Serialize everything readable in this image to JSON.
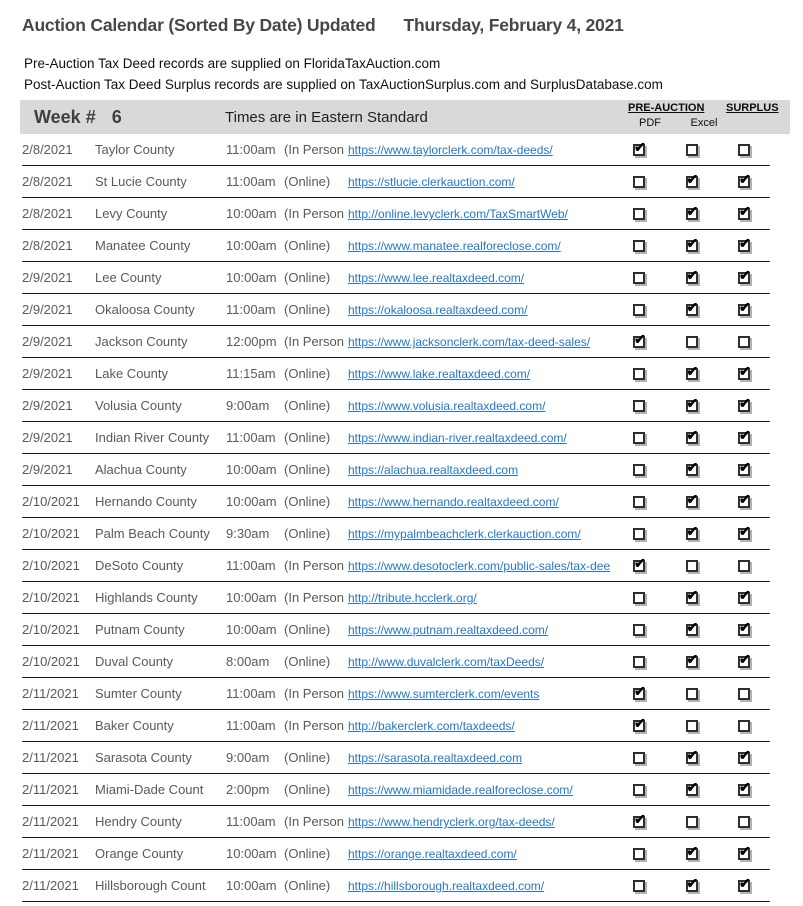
{
  "header": {
    "title": "Auction Calendar (Sorted By Date) Updated",
    "date": "Thursday, February 4, 2021"
  },
  "notes": [
    "Pre-Auction Tax Deed records are supplied on FloridaTaxAuction.com",
    "Post-Auction Tax Deed Surplus records are supplied on TaxAuctionSurplus.com and SurplusDatabase.com"
  ],
  "colors": {
    "link": "#2E75B6",
    "header_bar": "#D9D9D9",
    "body_text": "#595959"
  },
  "table": {
    "week_label": "Week #",
    "week_number": "6",
    "times_label": "Times are in Eastern Standard",
    "pre_auction_label": "PRE-AUCTION",
    "surplus_label": "SURPLUS",
    "pdf_label": "PDF",
    "excel_label": "Excel",
    "rows": [
      {
        "date": "2/8/2021",
        "county": "Taylor County",
        "time": "11:00am",
        "mode": "(In Person",
        "url": "https://www.taylorclerk.com/tax-deeds/",
        "pdf": true,
        "excel": false,
        "surplus": false
      },
      {
        "date": "2/8/2021",
        "county": "St Lucie County",
        "time": "11:00am",
        "mode": "(Online)",
        "url": "https://stlucie.clerkauction.com/",
        "pdf": false,
        "excel": true,
        "surplus": true
      },
      {
        "date": "2/8/2021",
        "county": "Levy County",
        "time": "10:00am",
        "mode": "(In Person",
        "url": "http://online.levyclerk.com/TaxSmartWeb/",
        "pdf": false,
        "excel": true,
        "surplus": true
      },
      {
        "date": "2/8/2021",
        "county": "Manatee County",
        "time": "10:00am",
        "mode": "(Online)",
        "url": "https://www.manatee.realforeclose.com/",
        "pdf": false,
        "excel": true,
        "surplus": true
      },
      {
        "date": "2/9/2021",
        "county": "Lee County",
        "time": "10:00am",
        "mode": "(Online)",
        "url": "https://www.lee.realtaxdeed.com/",
        "pdf": false,
        "excel": true,
        "surplus": true
      },
      {
        "date": "2/9/2021",
        "county": "Okaloosa County",
        "time": "11:00am",
        "mode": "(Online)",
        "url": "https://okaloosa.realtaxdeed.com/",
        "pdf": false,
        "excel": true,
        "surplus": true
      },
      {
        "date": "2/9/2021",
        "county": "Jackson County",
        "time": "12:00pm",
        "mode": "(In Person",
        "url": "https://www.jacksonclerk.com/tax-deed-sales/",
        "pdf": true,
        "excel": false,
        "surplus": false
      },
      {
        "date": "2/9/2021",
        "county": "Lake County",
        "time": "11:15am",
        "mode": "(Online)",
        "url": "https://www.lake.realtaxdeed.com/",
        "pdf": false,
        "excel": true,
        "surplus": true
      },
      {
        "date": "2/9/2021",
        "county": "Volusia County",
        "time": "9:00am",
        "mode": "(Online)",
        "url": "https://www.volusia.realtaxdeed.com/",
        "pdf": false,
        "excel": true,
        "surplus": true
      },
      {
        "date": "2/9/2021",
        "county": "Indian River County",
        "time": "11:00am",
        "mode": "(Online)",
        "url": "https://www.indian-river.realtaxdeed.com/",
        "pdf": false,
        "excel": true,
        "surplus": true
      },
      {
        "date": "2/9/2021",
        "county": "Alachua County",
        "time": "10:00am",
        "mode": "(Online)",
        "url": "https://alachua.realtaxdeed.com",
        "pdf": false,
        "excel": true,
        "surplus": true
      },
      {
        "date": "2/10/2021",
        "county": "Hernando County",
        "time": "10:00am",
        "mode": "(Online)",
        "url": "https://www.hernando.realtaxdeed.com/",
        "pdf": false,
        "excel": true,
        "surplus": true
      },
      {
        "date": "2/10/2021",
        "county": "Palm Beach County",
        "time": "9:30am",
        "mode": "(Online)",
        "url": "https://mypalmbeachclerk.clerkauction.com/",
        "pdf": false,
        "excel": true,
        "surplus": true
      },
      {
        "date": "2/10/2021",
        "county": "DeSoto County",
        "time": "11:00am",
        "mode": "(In Person",
        "url": "https://www.desotoclerk.com/public-sales/tax-dee",
        "pdf": true,
        "excel": false,
        "surplus": false
      },
      {
        "date": "2/10/2021",
        "county": "Highlands County",
        "time": "10:00am",
        "mode": "(In Person",
        "url": "http://tribute.hcclerk.org/",
        "pdf": false,
        "excel": true,
        "surplus": true
      },
      {
        "date": "2/10/2021",
        "county": "Putnam County",
        "time": "10:00am",
        "mode": "(Online)",
        "url": "https://www.putnam.realtaxdeed.com/",
        "pdf": false,
        "excel": true,
        "surplus": true
      },
      {
        "date": "2/10/2021",
        "county": "Duval County",
        "time": "8:00am",
        "mode": "(Online)",
        "url": "http://www.duvalclerk.com/taxDeeds/",
        "pdf": false,
        "excel": true,
        "surplus": true
      },
      {
        "date": "2/11/2021",
        "county": "Sumter County",
        "time": "11:00am",
        "mode": "(In Person",
        "url": "https://www.sumterclerk.com/events",
        "pdf": true,
        "excel": false,
        "surplus": false
      },
      {
        "date": "2/11/2021",
        "county": "Baker County",
        "time": "11:00am",
        "mode": "(In Person",
        "url": "http://bakerclerk.com/taxdeeds/",
        "pdf": true,
        "excel": false,
        "surplus": false
      },
      {
        "date": "2/11/2021",
        "county": "Sarasota County",
        "time": "9:00am",
        "mode": "(Online)",
        "url": "https://sarasota.realtaxdeed.com",
        "pdf": false,
        "excel": true,
        "surplus": true
      },
      {
        "date": "2/11/2021",
        "county": "Miami-Dade Count",
        "time": "2:00pm",
        "mode": "(Online)",
        "url": "https://www.miamidade.realforeclose.com/",
        "pdf": false,
        "excel": true,
        "surplus": true
      },
      {
        "date": "2/11/2021",
        "county": "Hendry County",
        "time": "11:00am",
        "mode": "(In Person",
        "url": "https://www.hendryclerk.org/tax-deeds/",
        "pdf": true,
        "excel": false,
        "surplus": false
      },
      {
        "date": "2/11/2021",
        "county": "Orange County",
        "time": "10:00am",
        "mode": "(Online)",
        "url": "https://orange.realtaxdeed.com/",
        "pdf": false,
        "excel": true,
        "surplus": true
      },
      {
        "date": "2/11/2021",
        "county": "Hillsborough Count",
        "time": "10:00am",
        "mode": "(Online)",
        "url": "https://hillsborough.realtaxdeed.com/",
        "pdf": false,
        "excel": true,
        "surplus": true
      }
    ]
  }
}
